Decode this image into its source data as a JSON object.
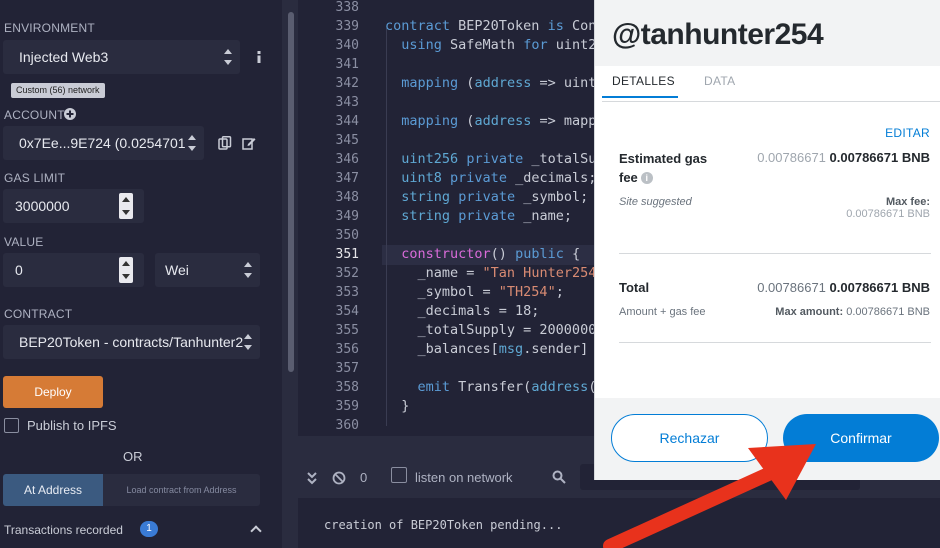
{
  "left_panel": {
    "environment_label": "ENVIRONMENT",
    "environment_value": "Injected Web3",
    "network_badge": "Custom (56) network",
    "account_label": "ACCOUNT",
    "account_value": "0x7Ee...9E724 (0.0254701",
    "gas_limit_label": "GAS LIMIT",
    "gas_limit_value": "3000000",
    "value_label": "VALUE",
    "value_amount": "0",
    "value_unit": "Wei",
    "contract_label": "CONTRACT",
    "contract_value": "BEP20Token - contracts/Tanhunter2",
    "deploy_label": "Deploy",
    "publish_label": "Publish to IPFS",
    "or_label": "OR",
    "at_address_label": "At Address",
    "load_address_label": "Load contract from Address",
    "transactions_label": "Transactions recorded",
    "transactions_count": "1"
  },
  "editor": {
    "active_line": 351,
    "lines": [
      {
        "n": "338",
        "t": ""
      },
      {
        "n": "339",
        "t": "contract BEP20Token is Con"
      },
      {
        "n": "340",
        "t": "  using SafeMath for uint2"
      },
      {
        "n": "341",
        "t": ""
      },
      {
        "n": "342",
        "t": "  mapping (address => uint"
      },
      {
        "n": "343",
        "t": ""
      },
      {
        "n": "344",
        "t": "  mapping (address => mapp"
      },
      {
        "n": "345",
        "t": ""
      },
      {
        "n": "346",
        "t": "  uint256 private _totalSu"
      },
      {
        "n": "347",
        "t": "  uint8 private _decimals;"
      },
      {
        "n": "348",
        "t": "  string private _symbol;"
      },
      {
        "n": "349",
        "t": "  string private _name;"
      },
      {
        "n": "350",
        "t": ""
      },
      {
        "n": "351",
        "t": "  constructor() public {"
      },
      {
        "n": "352",
        "t": "    _name = \"Tan Hunter254"
      },
      {
        "n": "353",
        "t": "    _symbol = \"TH254\";"
      },
      {
        "n": "354",
        "t": "    _decimals = 18;"
      },
      {
        "n": "355",
        "t": "    _totalSupply = 2000000"
      },
      {
        "n": "356",
        "t": "    _balances[msg.sender]"
      },
      {
        "n": "357",
        "t": ""
      },
      {
        "n": "358",
        "t": "    emit Transfer(address("
      },
      {
        "n": "359",
        "t": "  }"
      },
      {
        "n": "360",
        "t": ""
      }
    ]
  },
  "terminal": {
    "count": "0",
    "listen_label": "listen on network",
    "log_line": "creation of BEP20Token pending..."
  },
  "popup": {
    "title": "@tanhunter254",
    "tab_details": "DETALLES",
    "tab_data": "DATA",
    "edit_label": "EDITAR",
    "gas_fee_label": "Estimated gas fee",
    "gas_fee_muted": "0.00786671",
    "gas_fee_value": "0.00786671 BNB",
    "site_suggested": "Site suggested",
    "max_fee_label": "Max fee:",
    "max_fee_value": "0.00786671 BNB",
    "total_label": "Total",
    "total_muted": "0.00786671",
    "total_value": "0.00786671 BNB",
    "amount_gas_label": "Amount + gas fee",
    "max_amount_label": "Max amount:",
    "max_amount_value": "0.00786671 BNB",
    "reject_label": "Rechazar",
    "confirm_label": "Confirmar"
  },
  "colors": {
    "panel_bg": "#222336",
    "deploy_orange": "#d67b36",
    "metamask_blue": "#037dd6",
    "arrow_red": "#e8321c"
  }
}
